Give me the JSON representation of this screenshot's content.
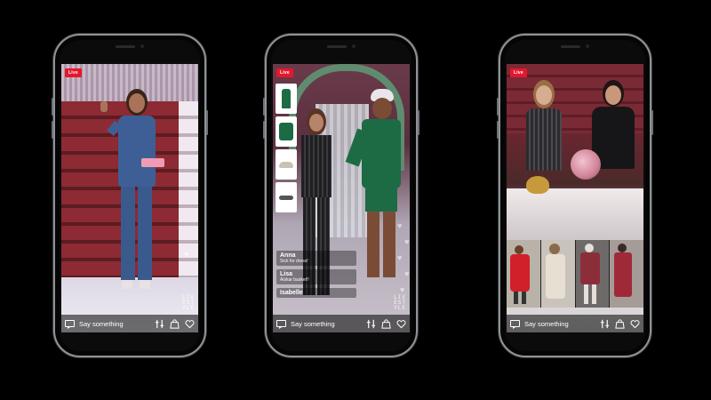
{
  "phones": [
    {
      "live_label": "Live",
      "brand_lines": [
        "LIV",
        "EST",
        "YLE"
      ],
      "input_placeholder": "Say something",
      "icons": [
        "chat-icon",
        "filter-icon",
        "shopping-bag-icon",
        "heart-icon"
      ]
    },
    {
      "live_label": "Live",
      "brand_lines": [
        "LIV",
        "EST",
        "YLE"
      ],
      "input_placeholder": "Say something",
      "products": [
        "green-dress-icon",
        "green-blazer-icon",
        "sneaker-icon",
        "sunglasses-icon"
      ],
      "comments": [
        {
          "name": "Anna",
          "text": "Sick for dress!"
        },
        {
          "name": "Lisa",
          "text": "Alskar basket!!"
        },
        {
          "name": "Isabelle",
          "text": ""
        }
      ],
      "icons": [
        "chat-icon",
        "filter-icon",
        "shopping-bag-icon",
        "heart-icon"
      ]
    },
    {
      "live_label": "Live",
      "input_placeholder": "Say something",
      "icons": [
        "chat-icon",
        "filter-icon",
        "shopping-bag-icon",
        "heart-icon"
      ]
    }
  ],
  "colors": {
    "live_red": "#e4172d",
    "phone_frame": "#8f9296",
    "background": "#000000"
  }
}
